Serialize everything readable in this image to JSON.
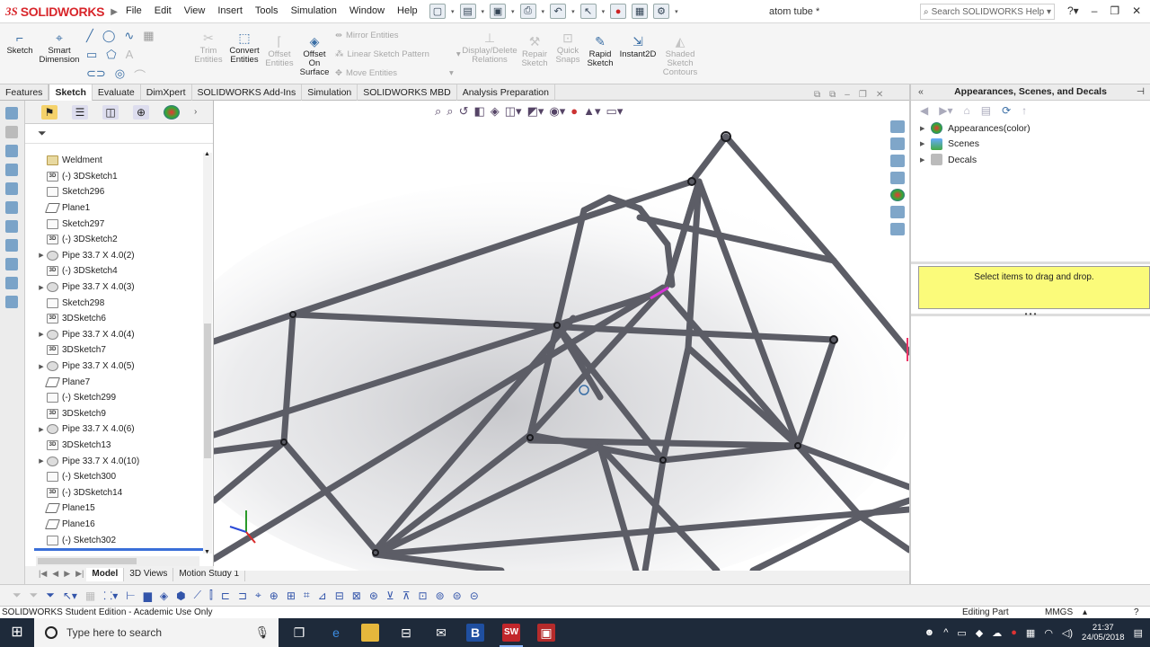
{
  "app": {
    "logo_ds": "3S",
    "logo_name": "SOLIDWORKS",
    "doc_title": "atom tube *",
    "help_search_placeholder": "Search SOLIDWORKS Help"
  },
  "menu": [
    "File",
    "Edit",
    "View",
    "Insert",
    "Tools",
    "Simulation",
    "Window",
    "Help"
  ],
  "commands": {
    "sketch": "Sketch",
    "smart_dimension_1": "Smart",
    "smart_dimension_2": "Dimension",
    "trim_1": "Trim",
    "trim_2": "Entities",
    "convert_1": "Convert",
    "convert_2": "Entities",
    "offset_1": "Offset",
    "offset_2": "Entities",
    "offset_surface_1": "Offset",
    "offset_surface_2": "On",
    "offset_surface_3": "Surface",
    "mirror": "Mirror Entities",
    "linear_pattern": "Linear Sketch Pattern",
    "move": "Move Entities",
    "display_relations_1": "Display/Delete",
    "display_relations_2": "Relations",
    "repair_1": "Repair",
    "repair_2": "Sketch",
    "quick_snaps_1": "Quick",
    "quick_snaps_2": "Snaps",
    "rapid_sketch_1": "Rapid",
    "rapid_sketch_2": "Sketch",
    "instant2d": "Instant2D",
    "shaded_1": "Shaded",
    "shaded_2": "Sketch",
    "shaded_3": "Contours"
  },
  "tabs": [
    "Features",
    "Sketch",
    "Evaluate",
    "DimXpert",
    "SOLIDWORKS Add-Ins",
    "Simulation",
    "SOLIDWORKS MBD",
    "Analysis Preparation"
  ],
  "active_tab": "Sketch",
  "tree": [
    {
      "label": "Weldment",
      "icon": "folder",
      "expand": ""
    },
    {
      "label": "(-) 3DSketch1",
      "icon": "3d",
      "expand": ""
    },
    {
      "label": "Sketch296",
      "icon": "sketch",
      "expand": ""
    },
    {
      "label": "Plane1",
      "icon": "plane",
      "expand": ""
    },
    {
      "label": "Sketch297",
      "icon": "sketch",
      "expand": ""
    },
    {
      "label": "(-) 3DSketch2",
      "icon": "3d",
      "expand": ""
    },
    {
      "label": "Pipe 33.7 X 4.0(2)",
      "icon": "pipe",
      "expand": "▶"
    },
    {
      "label": "(-) 3DSketch4",
      "icon": "3d",
      "expand": ""
    },
    {
      "label": "Pipe 33.7 X 4.0(3)",
      "icon": "pipe",
      "expand": "▶"
    },
    {
      "label": "Sketch298",
      "icon": "sketch",
      "expand": ""
    },
    {
      "label": "3DSketch6",
      "icon": "3d",
      "expand": ""
    },
    {
      "label": "Pipe 33.7 X 4.0(4)",
      "icon": "pipe",
      "expand": "▶"
    },
    {
      "label": "3DSketch7",
      "icon": "3d",
      "expand": ""
    },
    {
      "label": "Pipe 33.7 X 4.0(5)",
      "icon": "pipe",
      "expand": "▶"
    },
    {
      "label": "Plane7",
      "icon": "plane",
      "expand": ""
    },
    {
      "label": "(-) Sketch299",
      "icon": "sketch",
      "expand": ""
    },
    {
      "label": "3DSketch9",
      "icon": "3d",
      "expand": ""
    },
    {
      "label": "Pipe 33.7 X 4.0(6)",
      "icon": "pipe",
      "expand": "▶"
    },
    {
      "label": "3DSketch13",
      "icon": "3d",
      "expand": ""
    },
    {
      "label": "Pipe 33.7 X 4.0(10)",
      "icon": "pipe",
      "expand": "▶"
    },
    {
      "label": "(-) Sketch300",
      "icon": "sketch",
      "expand": ""
    },
    {
      "label": "(-) 3DSketch14",
      "icon": "3d",
      "expand": ""
    },
    {
      "label": "Plane15",
      "icon": "plane",
      "expand": ""
    },
    {
      "label": "Plane16",
      "icon": "plane",
      "expand": ""
    },
    {
      "label": "(-) Sketch302",
      "icon": "sketch",
      "expand": ""
    }
  ],
  "bottom_tabs": [
    "Model",
    "3D Views",
    "Motion Study 1"
  ],
  "taskpane": {
    "title": "Appearances, Scenes, and Decals",
    "items": [
      "Appearances(color)",
      "Scenes",
      "Decals"
    ],
    "drop_hint": "Select items to drag and drop."
  },
  "status": {
    "edition": "SOLIDWORKS Student Edition - Academic Use Only",
    "mode": "Editing Part",
    "units": "MMGS"
  },
  "taskbar": {
    "search_placeholder": "Type here to search",
    "time": "21:37",
    "date": "24/05/2018"
  },
  "colors": {
    "accent": "#d8262b",
    "tube": "#5c5d66",
    "dropzone": "#fbfb7a"
  }
}
